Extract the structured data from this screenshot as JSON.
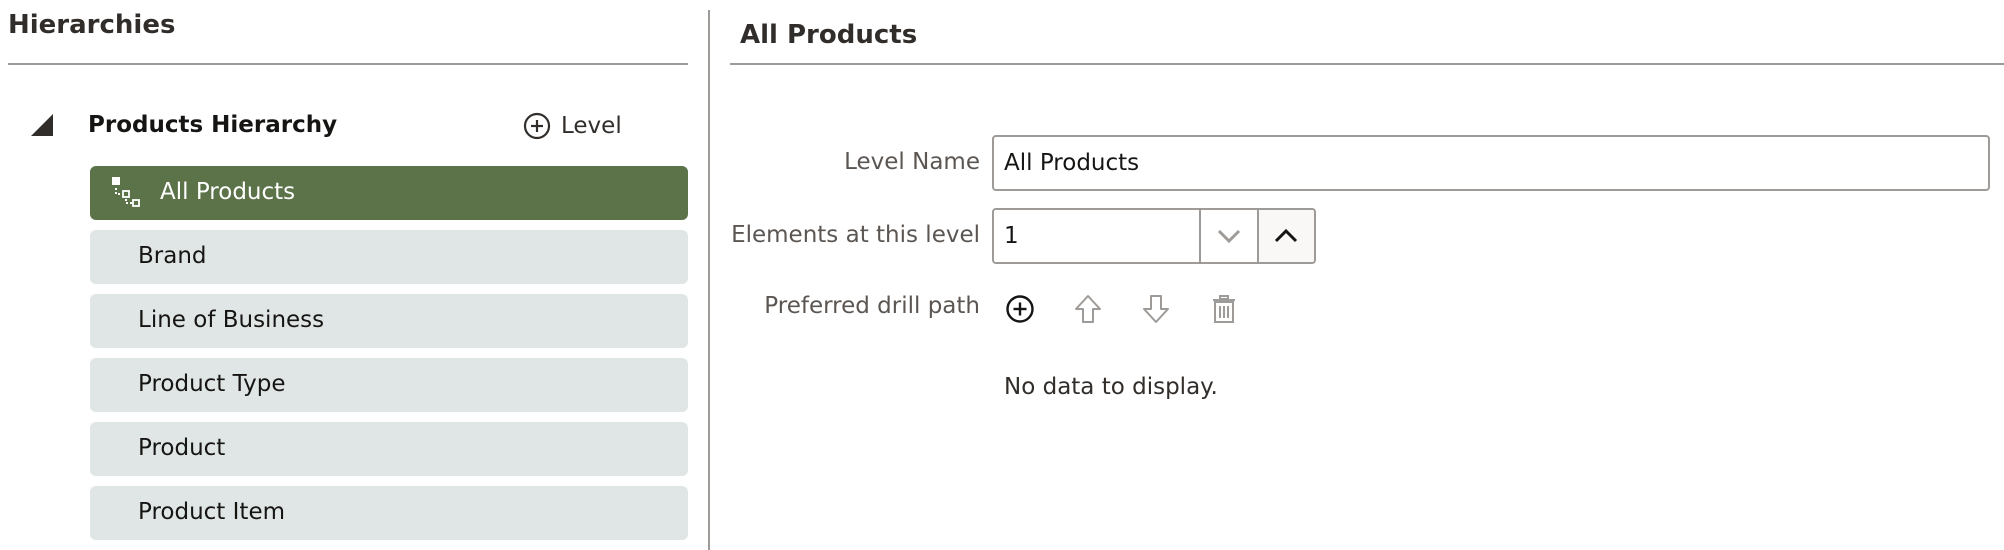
{
  "left_panel": {
    "title": "Hierarchies",
    "hierarchy": {
      "name": "Products Hierarchy",
      "add_level_label": "Level",
      "levels": [
        {
          "label": "All Products",
          "selected": true
        },
        {
          "label": "Brand",
          "selected": false
        },
        {
          "label": "Line of Business",
          "selected": false
        },
        {
          "label": "Product Type",
          "selected": false
        },
        {
          "label": "Product",
          "selected": false
        },
        {
          "label": "Product Item",
          "selected": false
        }
      ]
    }
  },
  "right_panel": {
    "title": "All Products",
    "level_name": {
      "label": "Level Name",
      "value": "All Products"
    },
    "elements": {
      "label": "Elements at this level",
      "value": "1"
    },
    "drill_path": {
      "label": "Preferred drill path",
      "tools": [
        "circle-plus-icon",
        "arrow-up-icon",
        "arrow-down-icon",
        "trash-icon"
      ]
    },
    "empty_message": "No data to display."
  },
  "colors": {
    "selected_level_bg": "#5c7349",
    "level_bg": "#dfe6e5",
    "border": "#9e9a97"
  }
}
